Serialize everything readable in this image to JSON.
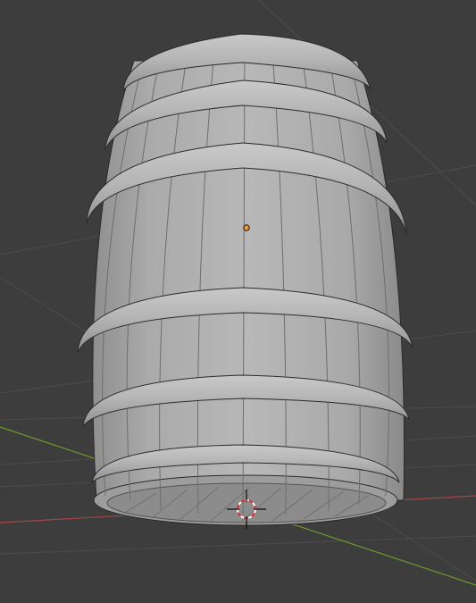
{
  "viewport": {
    "view": "3d-viewport",
    "shading": "solid",
    "object": "barrel",
    "colors": {
      "background": "#3d3d3d",
      "grid_line": "#4a4a4a",
      "axis_x": "#b24a4a",
      "axis_y": "#6f9a2a",
      "object_origin": "#f19a26",
      "cursor_red": "#d63434",
      "cursor_white": "#ffffff"
    },
    "icons": {
      "origin": "object-origin-icon",
      "cursor": "3d-cursor-icon"
    }
  }
}
